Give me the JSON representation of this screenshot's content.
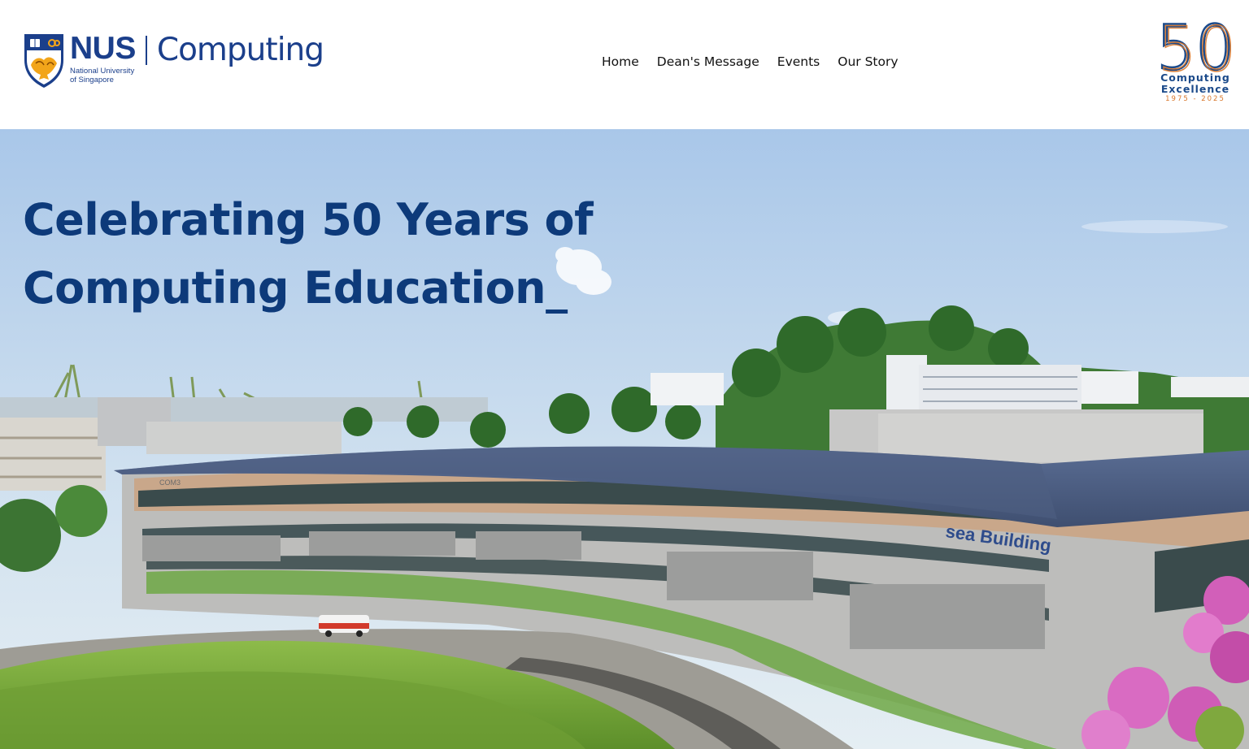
{
  "brand": {
    "nus": "NUS",
    "nus_sub_line1": "National University",
    "nus_sub_line2": "of Singapore",
    "faculty": "Computing"
  },
  "nav": {
    "items": [
      {
        "label": "Home"
      },
      {
        "label": "Dean's Message"
      },
      {
        "label": "Events"
      },
      {
        "label": "Our Story"
      }
    ]
  },
  "badge": {
    "number": "50",
    "line1": "Computing",
    "line2": "Excellence",
    "years": "1975 - 2025"
  },
  "hero": {
    "title_line1": "Celebrating 50 Years of",
    "title_line2": "Computing Education_",
    "building_sign": "sea Building",
    "block_sign": "COM3"
  },
  "colors": {
    "brand_blue": "#1b3f8b",
    "hero_title": "#0d3a7a",
    "badge_orange": "#d9772b"
  }
}
